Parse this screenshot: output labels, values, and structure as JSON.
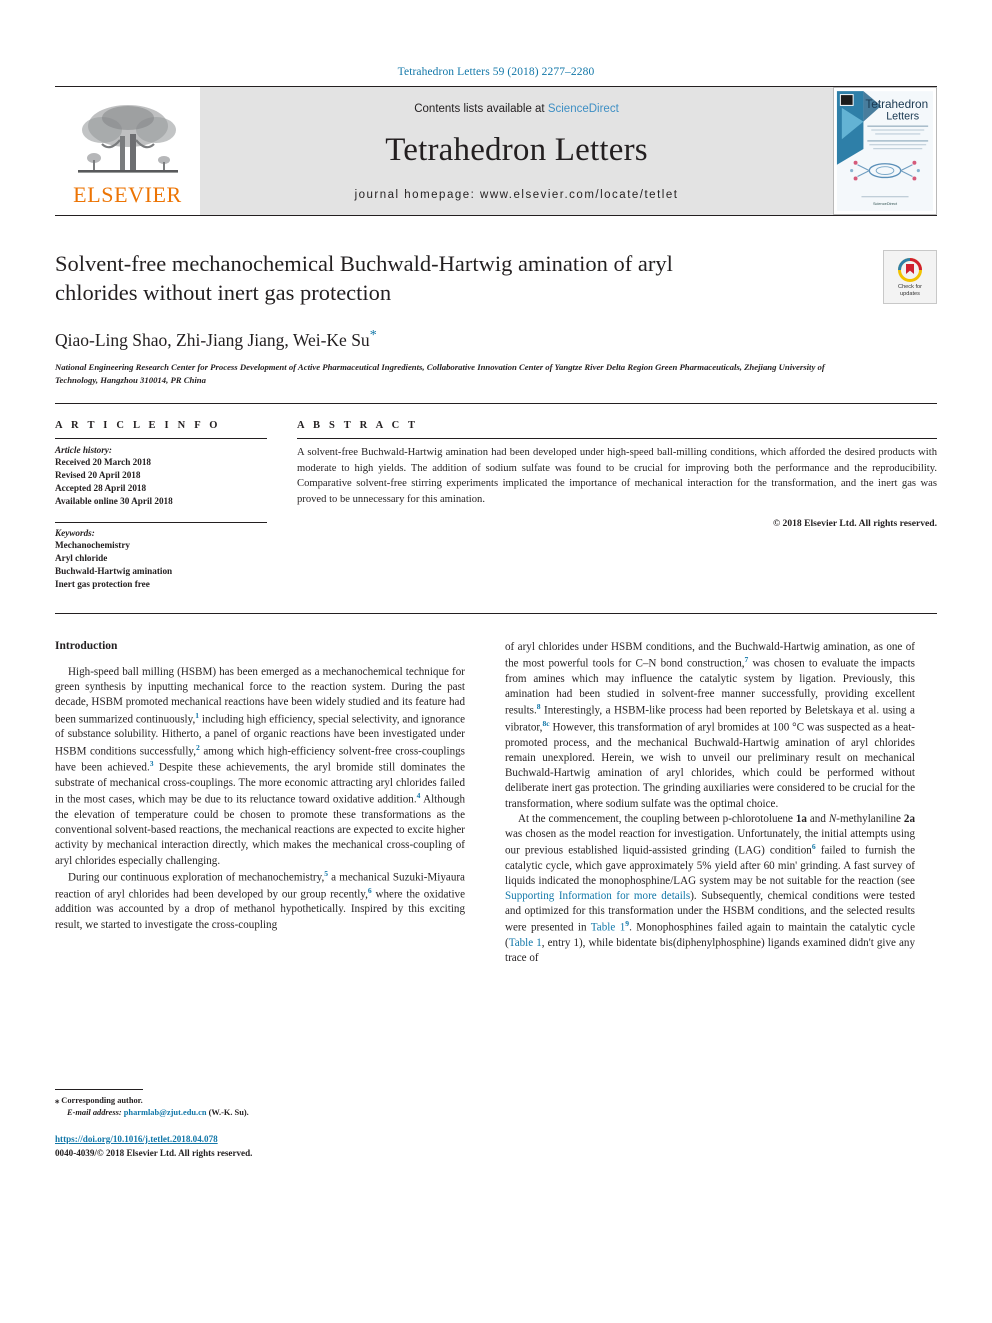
{
  "running_head": "Tetrahedron Letters 59 (2018) 2277–2280",
  "masthead": {
    "publisher_name": "ELSEVIER",
    "contents_prefix": "Contents lists available at ",
    "contents_link": "ScienceDirect",
    "journal_title": "Tetrahedron Letters",
    "homepage": "journal homepage: www.elsevier.com/locate/tetlet",
    "cover_title_line1": "Tetrahedron",
    "cover_title_line2": "Letters"
  },
  "crossmark": {
    "line1": "Check for",
    "line2": "updates"
  },
  "title": "Solvent-free mechanochemical Buchwald-Hartwig amination of aryl chlorides without inert gas protection",
  "authors": "Qiao-Ling Shao, Zhi-Jiang Jiang, Wei-Ke Su",
  "author_star": "*",
  "affiliation": "National Engineering Research Center for Process Development of Active Pharmaceutical Ingredients, Collaborative Innovation Center of Yangtze River Delta Region Green Pharmaceuticals, Zhejiang University of Technology, Hangzhou 310014, PR China",
  "article_info": {
    "heading": "A R T I C L E   I N F O",
    "history_label": "Article history:",
    "history": [
      "Received 20 March 2018",
      "Revised 20 April 2018",
      "Accepted 28 April 2018",
      "Available online 30 April 2018"
    ],
    "keywords_label": "Keywords:",
    "keywords": [
      "Mechanochemistry",
      "Aryl chloride",
      "Buchwald-Hartwig amination",
      "Inert gas protection free"
    ]
  },
  "abstract": {
    "heading": "A B S T R A C T",
    "text": "A solvent-free Buchwald-Hartwig amination had been developed under high-speed ball-milling conditions, which afforded the desired products with moderate to high yields. The addition of sodium sulfate was found to be crucial for improving both the performance and the reproducibility. Comparative solvent-free stirring experiments implicated the importance of mechanical interaction for the transformation, and the inert gas was proved to be unnecessary for this amination.",
    "copyright": "© 2018 Elsevier Ltd. All rights reserved."
  },
  "body": {
    "section_heading": "Introduction",
    "left_paragraphs": [
      "High-speed ball milling (HSBM) has been emerged as a mechanochemical technique for green synthesis by inputting mechanical force to the reaction system. During the past decade, HSBM promoted mechanical reactions have been widely studied and its feature had been summarized continuously,<sup class=\"ref\">1</sup> including high efficiency, special selectivity, and ignorance of substance solubility. Hitherto, a panel of organic reactions have been investigated under HSBM conditions successfully,<sup class=\"ref\">2</sup> among which high-efficiency solvent-free cross-couplings have been achieved.<sup class=\"ref\">3</sup> Despite these achievements, the aryl bromide still dominates the substrate of mechanical cross-couplings. The more economic attracting aryl chlorides failed in the most cases, which may be due to its reluctance toward oxidative addition.<sup class=\"ref\">4</sup> Although the elevation of temperature could be chosen to promote these transformations as the conventional solvent-based reactions, the mechanical reactions are expected to excite higher activity by mechanical interaction directly, which makes the mechanical cross-coupling of aryl chlorides especially challenging.",
      "During our continuous exploration of mechanochemistry,<sup class=\"ref\">5</sup> a mechanical Suzuki-Miyaura reaction of aryl chlorides had been developed by our group recently,<sup class=\"ref\">6</sup> where the oxidative addition was accounted by a drop of methanol hypothetically. Inspired by this exciting result, we started to investigate the cross-coupling"
    ],
    "right_paragraphs": [
      "of aryl chlorides under HSBM conditions, and the Buchwald-Hartwig amination, as one of the most powerful tools for C–N bond construction,<sup class=\"ref\">7</sup> was chosen to evaluate the impacts from amines which may influence the catalytic system by ligation. Previously, this amination had been studied in solvent-free manner successfully, providing excellent results.<sup class=\"ref\">8</sup> Interestingly, a HSBM-like process had been reported by Beletskaya et al. using a vibrator,<sup class=\"ref\">8c</sup> However, this transformation of aryl bromides at 100 °C was suspected as a heat-promoted process, and the mechanical Buchwald-Hartwig amination of aryl chlorides remain unexplored. Herein, we wish to unveil our preliminary result on mechanical Buchwald-Hartwig amination of aryl chlorides, which could be performed without deliberate inert gas protection. The grinding auxiliaries were considered to be crucial for the transformation, where sodium sulfate was the optimal choice.",
      "At the commencement, the coupling between p-chlorotoluene <b>1a</b> and <i>N</i>-methylaniline <b>2a</b> was chosen as the model reaction for investigation. Unfortunately, the initial attempts using our previous established liquid-assisted grinding (LAG) condition<sup class=\"ref\">6</sup> failed to furnish the catalytic cycle, which gave approximately 5% yield after 60 min' grinding. A fast survey of liquids indicated the monophosphine/LAG system may be not suitable for the reaction (see <a class=\"ilink\" href=\"#\">Supporting Information for more details</a>). Subsequently, chemical conditions were tested and optimized for this transformation under the HSBM conditions, and the selected results were presented in <a class=\"ilink\" href=\"#\">Table 1</a><sup class=\"ref\">9</sup>. Monophosphines failed again to maintain the catalytic cycle (<a class=\"ilink\" href=\"#\">Table 1</a>, entry 1), while bidentate bis(diphenylphosphine) ligands examined didn't give any trace of"
    ]
  },
  "footnote": {
    "corresponding_marker": "⁎",
    "corresponding_label": "Corresponding author.",
    "email_label": "E-mail address:",
    "email": "pharmlab@zjut.edu.cn",
    "email_suffix": "(W.-K. Su).",
    "doi": "https://doi.org/10.1016/j.tetlet.2018.04.078",
    "issn_line": "0040-4039/© 2018 Elsevier Ltd. All rights reserved."
  },
  "colors": {
    "link": "#1277a8",
    "elsevier_orange": "#ec7404",
    "band_gray": "#e3e3e3",
    "sciencedirect": "#3e8fc4"
  }
}
